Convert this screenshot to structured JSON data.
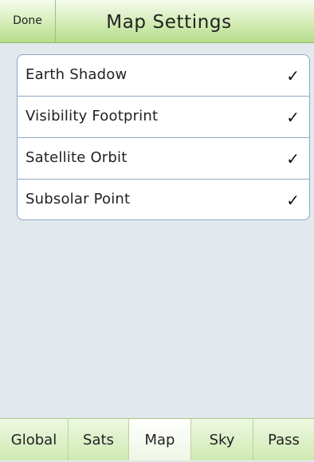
{
  "header": {
    "done_label": "Done",
    "title": "Map Settings"
  },
  "settings": {
    "items": [
      {
        "label": "Earth Shadow",
        "checked": true,
        "mark": "✓"
      },
      {
        "label": "Visibility Footprint",
        "checked": true,
        "mark": "✓"
      },
      {
        "label": "Satellite Orbit",
        "checked": true,
        "mark": "✓"
      },
      {
        "label": "Subsolar Point",
        "checked": true,
        "mark": "✓"
      }
    ]
  },
  "tabbar": {
    "tabs": [
      {
        "label": "Global"
      },
      {
        "label": "Sats"
      },
      {
        "label": "Map"
      },
      {
        "label": "Sky"
      },
      {
        "label": "Pass"
      }
    ],
    "active": "Map"
  },
  "colors": {
    "background": "#e2e9ed",
    "accent_green": "#cfeab2",
    "list_border": "#8fa7c4"
  }
}
